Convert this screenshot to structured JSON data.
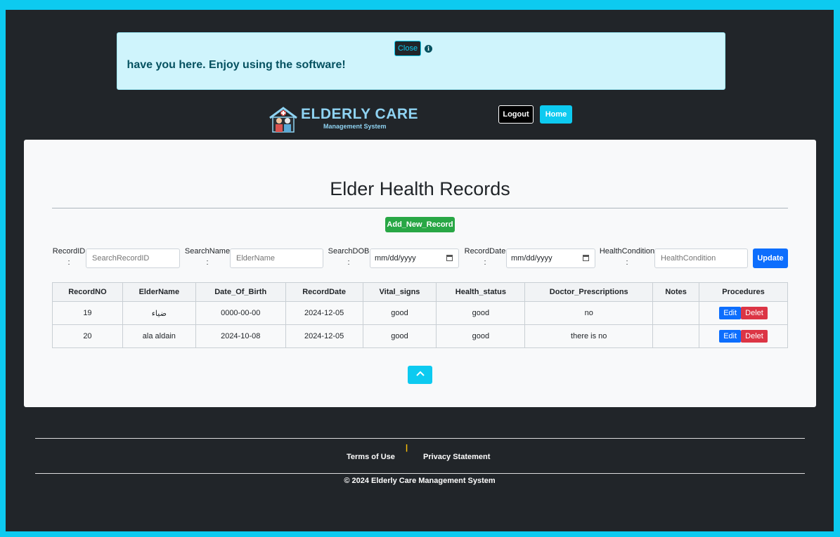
{
  "banner": {
    "close_label": "Close",
    "info_icon": "info-circle-icon",
    "marquee_text": "Glad to have you here. Enjoy using the software!"
  },
  "header": {
    "logo_title": "ELDERLY CARE",
    "logo_subtitle": "Management System",
    "logout_label": "Logout",
    "home_label": "Home"
  },
  "main": {
    "title": "Elder Health Records",
    "add_label": "Add_New_Record",
    "filters": {
      "record_id_label": "RecordID :",
      "record_id_placeholder": "SearchRecordID",
      "name_label": "SearchName :",
      "name_placeholder": "ElderName",
      "dob_label": "SearchDOB :",
      "dob_value": "mm/dd/yyyy",
      "record_date_label": "RecordDate :",
      "record_date_value": "mm/dd/yyyy",
      "condition_label": "HealthCondition :",
      "condition_placeholder": "HealthCondition",
      "update_label": "Update"
    },
    "table": {
      "headers": [
        "RecordNO",
        "ElderName",
        "Date_Of_Birth",
        "RecordDate",
        "Vital_signs",
        "Health_status",
        "Doctor_Prescriptions",
        "Notes",
        "Procedures"
      ],
      "rows": [
        [
          "19",
          "ضياء",
          "0000-00-00",
          "2024-12-05",
          "good",
          "good",
          "no",
          ""
        ],
        [
          "20",
          "ala aldain",
          "2024-10-08",
          "2024-12-05",
          "good",
          "good",
          "there is no",
          ""
        ]
      ],
      "edit_label": "Edit",
      "delete_label": "Delet"
    },
    "scroll_top_icon": "chevron-up-icon"
  },
  "footer": {
    "terms_label": "Terms of Use",
    "separator": "|",
    "privacy_label": "Privacy Statement",
    "copyright": "© 2024 Elderly Care Management System"
  },
  "colors": {
    "outer_border": "#0dcaf0",
    "background": "#212529",
    "banner_bg": "#cff4fc",
    "add_button": "#28a745",
    "edit_button": "#0d6efd",
    "delete_button": "#dc3545"
  }
}
